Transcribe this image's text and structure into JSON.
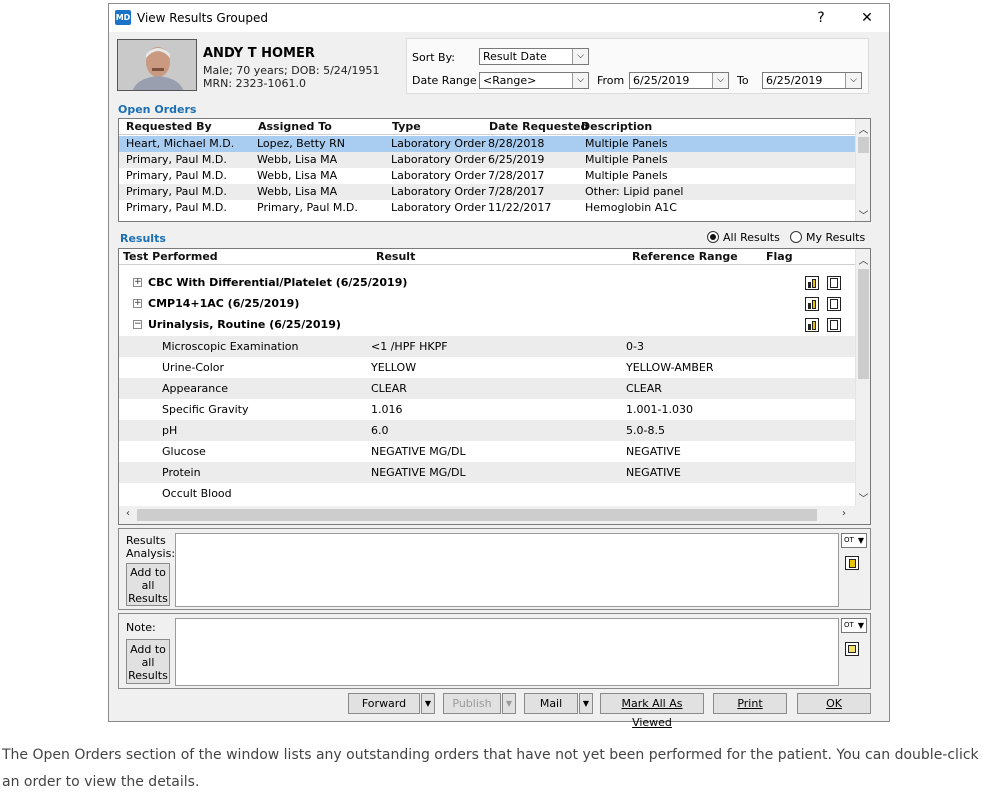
{
  "window": {
    "title": "View Results Grouped",
    "app_icon_text": "MD",
    "help_label": "?",
    "close_label": "✕"
  },
  "patient": {
    "name": "ANDY T HOMER",
    "info": "Male; 70 years;  DOB:  5/24/1951 MRN: 2323-1061.0"
  },
  "sort": {
    "sort_by_label": "Sort By:",
    "sort_by_value": "Result Date",
    "date_range_label": "Date Range",
    "date_range_value": "<Range>",
    "from_label": "From",
    "from_value": "6/25/2019",
    "to_label": "To",
    "to_value": "6/25/2019"
  },
  "open_orders": {
    "title": "Open Orders",
    "columns": [
      "Requested By",
      "Assigned To",
      "Type",
      "Date Requested",
      "Description"
    ],
    "rows": [
      [
        "Heart, Michael M.D.",
        "Lopez, Betty RN",
        "Laboratory Order",
        "8/28/2018",
        "Multiple Panels"
      ],
      [
        "Primary, Paul M.D.",
        "Webb, Lisa MA",
        "Laboratory Order",
        "6/25/2019",
        "Multiple Panels"
      ],
      [
        "Primary, Paul M.D.",
        "Webb, Lisa MA",
        "Laboratory Order",
        "7/28/2017",
        "Multiple Panels"
      ],
      [
        "Primary, Paul M.D.",
        "Webb, Lisa MA",
        "Laboratory Order",
        "7/28/2017",
        "Other: Lipid panel"
      ],
      [
        "Primary, Paul M.D.",
        "Primary, Paul M.D.",
        "Laboratory Order",
        "11/22/2017",
        "Hemoglobin A1C"
      ]
    ]
  },
  "results": {
    "title": "Results",
    "all_results_label": "All Results",
    "my_results_label": "My Results",
    "selected_filter": "All Results",
    "columns": [
      "Test Performed",
      "Result",
      "Reference Range",
      "Flag"
    ],
    "groups": [
      {
        "label": "CBC With Differential/Platelet  (6/25/2019)",
        "expander": "+"
      },
      {
        "label": "CMP14+1AC  (6/25/2019)",
        "expander": "+"
      },
      {
        "label": "Urinalysis, Routine  (6/25/2019)",
        "expander": "−"
      }
    ],
    "rows": [
      [
        "Microscopic Examination",
        "<1 /HPF HKPF",
        "0-3",
        ""
      ],
      [
        "Urine-Color",
        "YELLOW",
        "YELLOW-AMBER",
        ""
      ],
      [
        "Appearance",
        "CLEAR",
        "CLEAR",
        ""
      ],
      [
        "Specific Gravity",
        "1.016",
        "1.001-1.030",
        ""
      ],
      [
        "pH",
        "6.0",
        "5.0-8.5",
        ""
      ],
      [
        "Glucose",
        "NEGATIVE MG/DL",
        "NEGATIVE",
        ""
      ],
      [
        "Protein",
        "NEGATIVE MG/DL",
        "NEGATIVE",
        ""
      ],
      [
        "Occult Blood",
        "",
        "",
        ""
      ]
    ]
  },
  "analysis": {
    "label": "Results Analysis:",
    "add_label": "Add to all Results",
    "ot_label": "OT"
  },
  "note": {
    "label": "Note:",
    "add_label": "Add to all Results",
    "ot_label": "OT"
  },
  "buttons": {
    "forward": "Forward",
    "publish": "Publish",
    "mail": "Mail",
    "mark_all": "Mark All As Viewed",
    "print": "Print",
    "ok": "OK"
  },
  "caption": "The Open Orders section of the window lists any outstanding orders that have not yet been performed for the patient. You can double-click an order to view the details.",
  "colors": {
    "selected_row": "#a9cdf0",
    "alt_row": "#ececec",
    "section_title": "#1b6fb2"
  }
}
